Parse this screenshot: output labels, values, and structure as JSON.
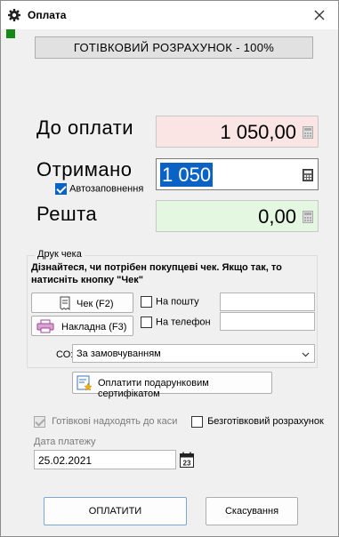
{
  "window": {
    "title": "Оплата"
  },
  "colors": {
    "accent": "#0a63c4",
    "pay_bg": "#fbe4e4",
    "change_bg": "#e4f7e1",
    "status_green": "#138a13"
  },
  "mode_button": {
    "label": "ГОТІВКОВИЙ РОЗРАХУНОК - 100%"
  },
  "amounts": {
    "to_pay": {
      "label": "До оплати",
      "value": "1 050,00"
    },
    "received": {
      "label": "Отримано",
      "value": "1 050"
    },
    "change": {
      "label": "Решта",
      "value": "0,00"
    }
  },
  "autofill": {
    "label": "Автозаповнення",
    "checked": true
  },
  "print_group": {
    "title": "Друк чека",
    "hint": "Дізнайтеся, чи потрібен покупцеві чек. Якщо так, то натисніть кнопку \"Чек\"",
    "receipt_button": "Чек (F2)",
    "invoice_button": "Накладна (F3)",
    "email_option": "На пошту",
    "phone_option": "На телефон",
    "email_value": "",
    "phone_value": "",
    "co_label": "СО:",
    "co_value": "За замовчуванням"
  },
  "gift_certificate_button": "Оплатити подарунковим сертифікатом",
  "cash_to_register": {
    "label": "Готівкові надходять до каси",
    "checked": true,
    "disabled": true
  },
  "noncash": {
    "label": "Безготівковий розрахунок",
    "checked": false
  },
  "payment_date": {
    "label": "Дата платежу",
    "value": "25.02.2021",
    "calendar_day": "23"
  },
  "footer": {
    "ok_label": "ОПЛАТИТИ",
    "cancel_label": "Скасування"
  },
  "icons": [
    "gear-icon",
    "close-icon",
    "calculator-icon",
    "receipt-icon",
    "printer-icon",
    "chevron-down-icon",
    "gift-certificate-icon",
    "calendar-icon"
  ]
}
